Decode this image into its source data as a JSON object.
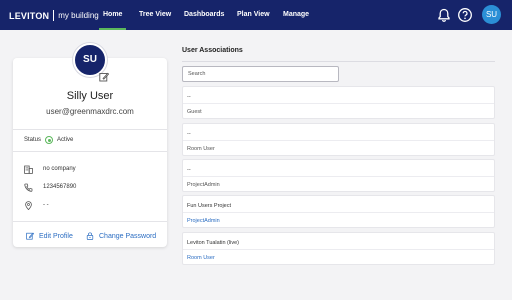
{
  "header": {
    "brand": "LEVITON",
    "product": "my building",
    "nav": [
      {
        "label": "Home",
        "active": true
      },
      {
        "label": "Tree View",
        "active": false
      },
      {
        "label": "Dashboards",
        "active": false
      },
      {
        "label": "Plan View",
        "active": false
      },
      {
        "label": "Manage",
        "active": false
      }
    ],
    "icons": [
      "bell-icon",
      "help-icon"
    ],
    "avatar_initials": "SU"
  },
  "profile": {
    "initials": "SU",
    "name": "Silly User",
    "email": "user@greenmaxdrc.com",
    "status_label": "Status",
    "status_value": "Active",
    "status_color": "#5cb85c",
    "company": "no company",
    "phone": "1234567890",
    "location": "- -",
    "edit_profile": "Edit Profile",
    "change_password": "Change Password"
  },
  "associations": {
    "title": "User Associations",
    "search_placeholder": "Search",
    "items": [
      {
        "name": "--",
        "role": "Guest",
        "role_link": false
      },
      {
        "name": "--",
        "role": "Room User",
        "role_link": false
      },
      {
        "name": "--",
        "role": "ProjectAdmin",
        "role_link": false
      },
      {
        "name": "Fun Users Project",
        "role": "ProjectAdmin",
        "role_link": true
      },
      {
        "name": "Leviton Tualatin (live)",
        "role": "Room User",
        "role_link": true
      }
    ]
  },
  "colors": {
    "nav_bg": "#16246a",
    "accent": "#2b6dc2",
    "active_tab_underline": "#5cb85c"
  }
}
